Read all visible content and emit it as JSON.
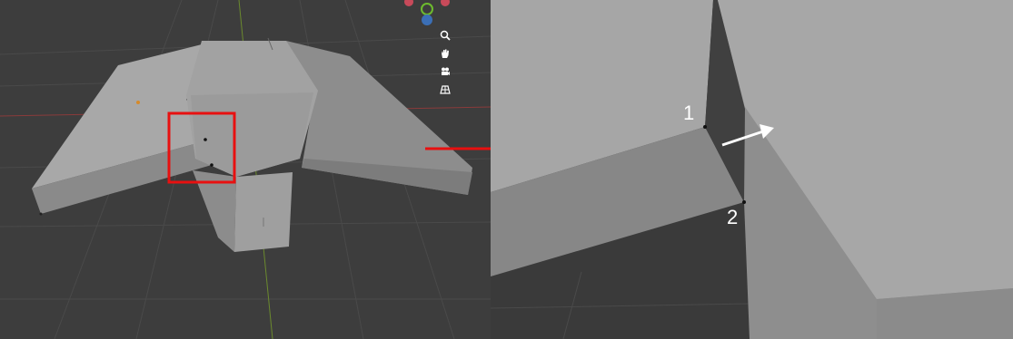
{
  "viewport": {
    "background": "#3d3d3d",
    "mesh_color": "#a9a9a9",
    "highlight_color": "#e81010"
  },
  "navigation_gizmo": {
    "axes": [
      "y-axis",
      "z-axis"
    ],
    "buttons": [
      {
        "icon": "zoom-icon"
      },
      {
        "icon": "hand-pan-icon"
      },
      {
        "icon": "camera-icon"
      },
      {
        "icon": "grid-perspective-icon"
      }
    ]
  },
  "annotations": {
    "vertex_1_label": "1",
    "vertex_2_label": "2",
    "pointer_arrow_color": "#ffffff",
    "zoom_arrow_color": "#e81010"
  }
}
